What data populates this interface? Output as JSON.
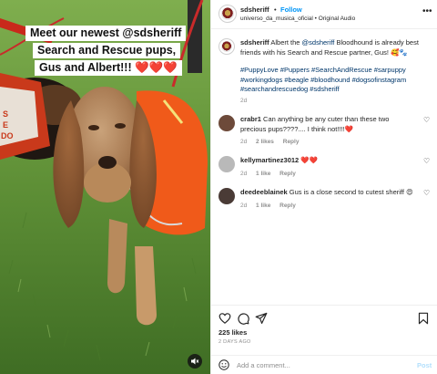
{
  "media": {
    "caption_lines": [
      "Meet our newest @sdsheriff",
      "Search and Rescue pups,",
      "Gus and Albert!!! ❤️❤️❤️"
    ],
    "vest_text": "DO",
    "mute_icon": "speaker-muted-icon"
  },
  "header": {
    "username": "sdsheriff",
    "dot": "•",
    "follow_label": "Follow",
    "audio": "universo_da_musica_oficial • Original Audio",
    "more": "•••"
  },
  "post": {
    "username": "sdsheriff",
    "text_before_mention": " Albert the ",
    "mention": "@sdsheriff",
    "text_after_mention": " Bloodhound is already best friends with his Search and Rescue partner, Gus! 🥰🐾",
    "hashtags": "#PuppyLove #Puppers #SearchAndRescue #sarpuppy #workingdogs #beagle #bloodhound #dogsofinstagram #searchandrescuedog #sdsheriff",
    "age": "2d"
  },
  "comments": [
    {
      "username": "crabr1",
      "text": " Can anything be any cuter than these two precious pups????.... I think not!!!!❤️",
      "age": "2d",
      "likes": "2 likes",
      "reply": "Reply"
    },
    {
      "username": "kellymartinez3012",
      "text": " ❤️❤️",
      "age": "2d",
      "likes": "1 like",
      "reply": "Reply"
    },
    {
      "username": "deedeeblainek",
      "text": " Gus is a close second to cutest sheriff 😍",
      "age": "2d",
      "likes": "1 like",
      "reply": "Reply"
    }
  ],
  "actions": {
    "likes": "225 likes",
    "date": "2 DAYS AGO"
  },
  "add_comment": {
    "placeholder": "Add a comment...",
    "post_label": "Post"
  },
  "colors": {
    "accent": "#0095f6",
    "link": "#00376b",
    "muted": "#8e8e8e",
    "vest": "#f05a1a",
    "grass": "#5d8b3a"
  }
}
